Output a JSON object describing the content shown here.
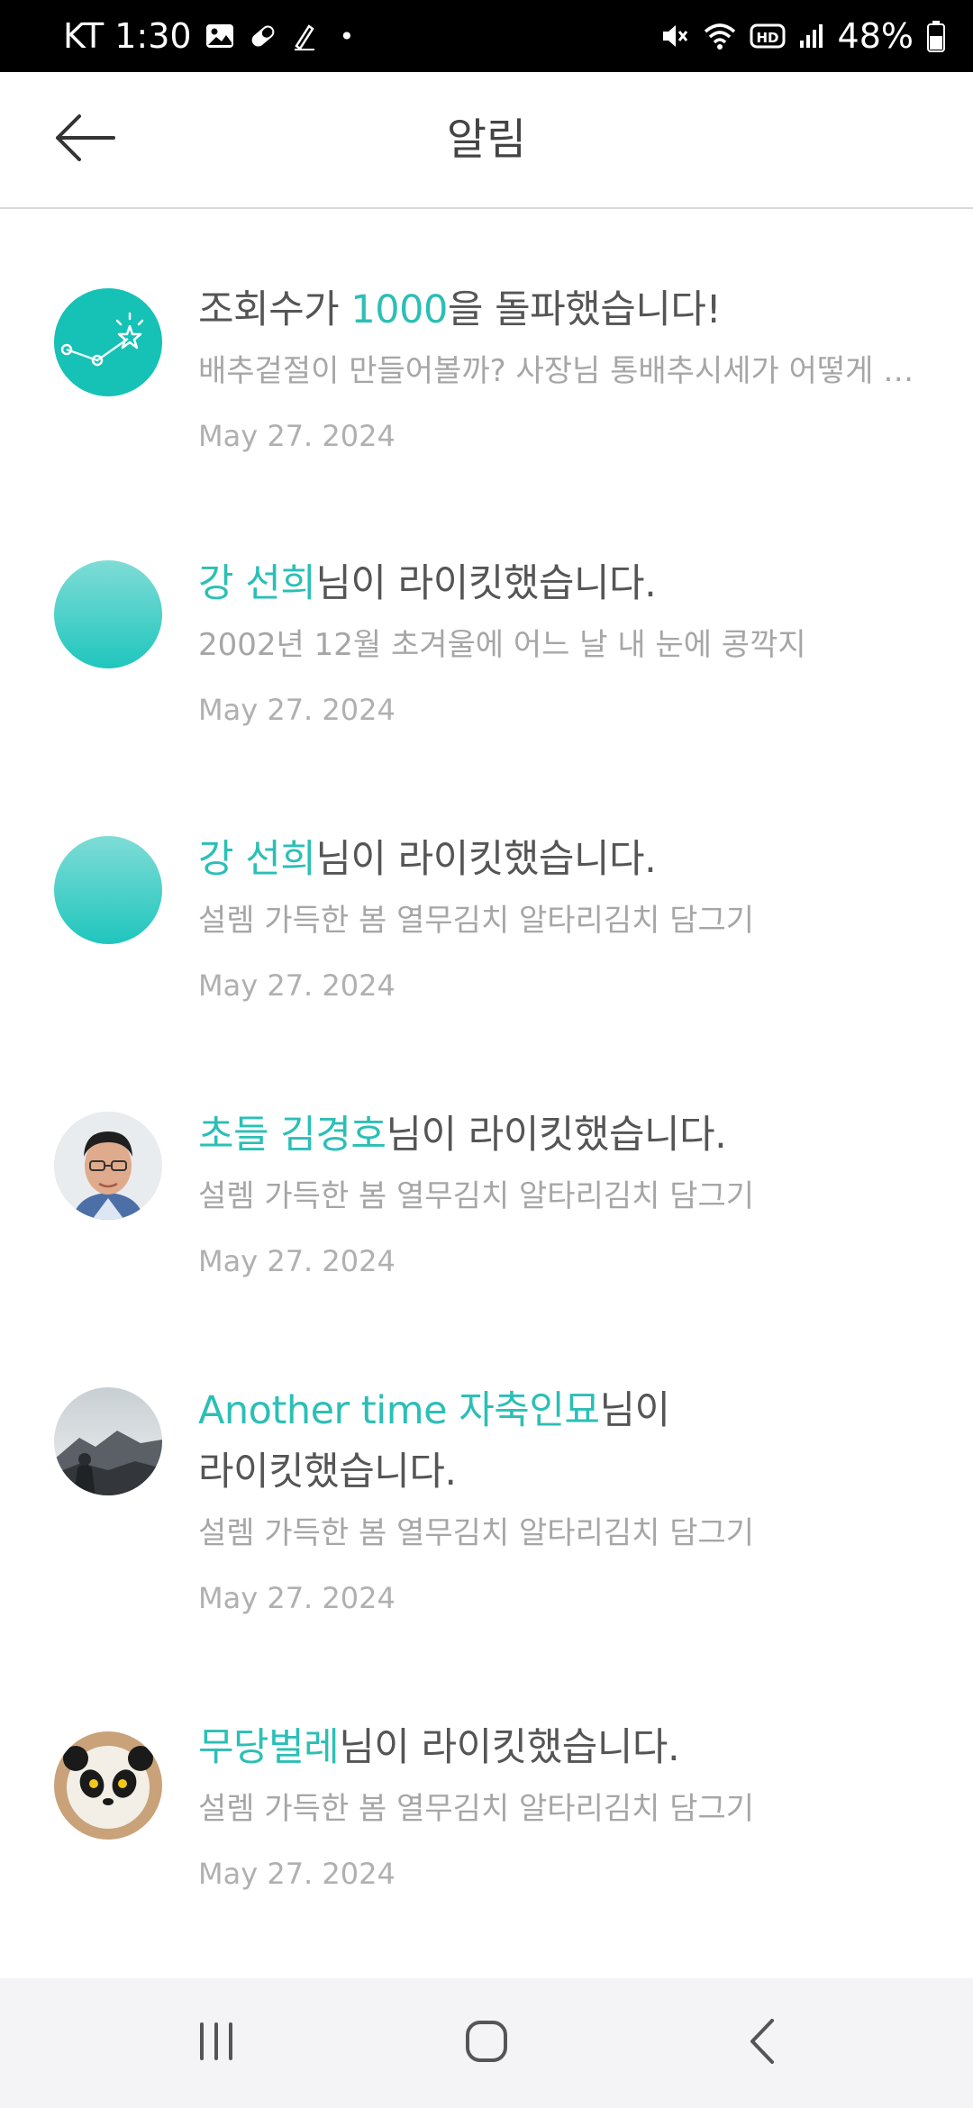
{
  "status_bar": {
    "carrier_time": "KT 1:30",
    "dot": "•",
    "battery": "48%",
    "icons": [
      "gallery-icon",
      "pill-icon",
      "pen-icon",
      "mute-icon",
      "wifi-icon",
      "hd-icon",
      "signal-icon",
      "battery-icon"
    ]
  },
  "header": {
    "back_icon": "back-arrow-icon",
    "title": "알림"
  },
  "colors": {
    "accent": "#2bbfb6",
    "title_text": "#555555",
    "sub_text": "#a6a6a6"
  },
  "notifications": [
    {
      "avatar": "views-milestone-icon",
      "title_hl": "",
      "title_pre": "조회수가 ",
      "title_num": "1000",
      "title_rest": "을 돌파했습니다!",
      "subtitle": "배추겉절이 만들어볼까? 사장님 통배추시세가 어떻게 되나요?",
      "date": "May 27. 2024"
    },
    {
      "avatar": "teal-avatar",
      "title_hl": "강 선희",
      "title_rest": "님이 라이킷했습니다.",
      "subtitle": "2002년 12월 초겨울에 어느 날 내 눈에 콩깍지",
      "date": "May 27. 2024"
    },
    {
      "avatar": "teal-avatar",
      "title_hl": "강 선희",
      "title_rest": "님이 라이킷했습니다.",
      "subtitle": "설렘 가득한 봄 열무김치 알타리김치 담그기",
      "date": "May 27. 2024"
    },
    {
      "avatar": "profile-photo-man",
      "title_hl": "초들 김경호",
      "title_rest": "님이 라이킷했습니다.",
      "subtitle": "설렘 가득한 봄 열무김치 알타리김치 담그기",
      "date": "May 27. 2024"
    },
    {
      "avatar": "profile-photo-mountain",
      "title_hl": "Another time 자축인묘",
      "title_rest": "님이",
      "title_line2": "라이킷했습니다.",
      "subtitle": "설렘 가득한 봄 열무김치 알타리김치 담그기",
      "date": "May 27. 2024"
    },
    {
      "avatar": "profile-photo-panda",
      "title_hl": "무당벌레",
      "title_rest": "님이 라이킷했습니다.",
      "subtitle": "설렘 가득한 봄 열무김치 알타리김치 담그기",
      "date": "May 27. 2024"
    }
  ],
  "nav_bar": {
    "recents_icon": "recents-icon",
    "home_icon": "home-icon",
    "back_icon": "nav-back-icon"
  }
}
